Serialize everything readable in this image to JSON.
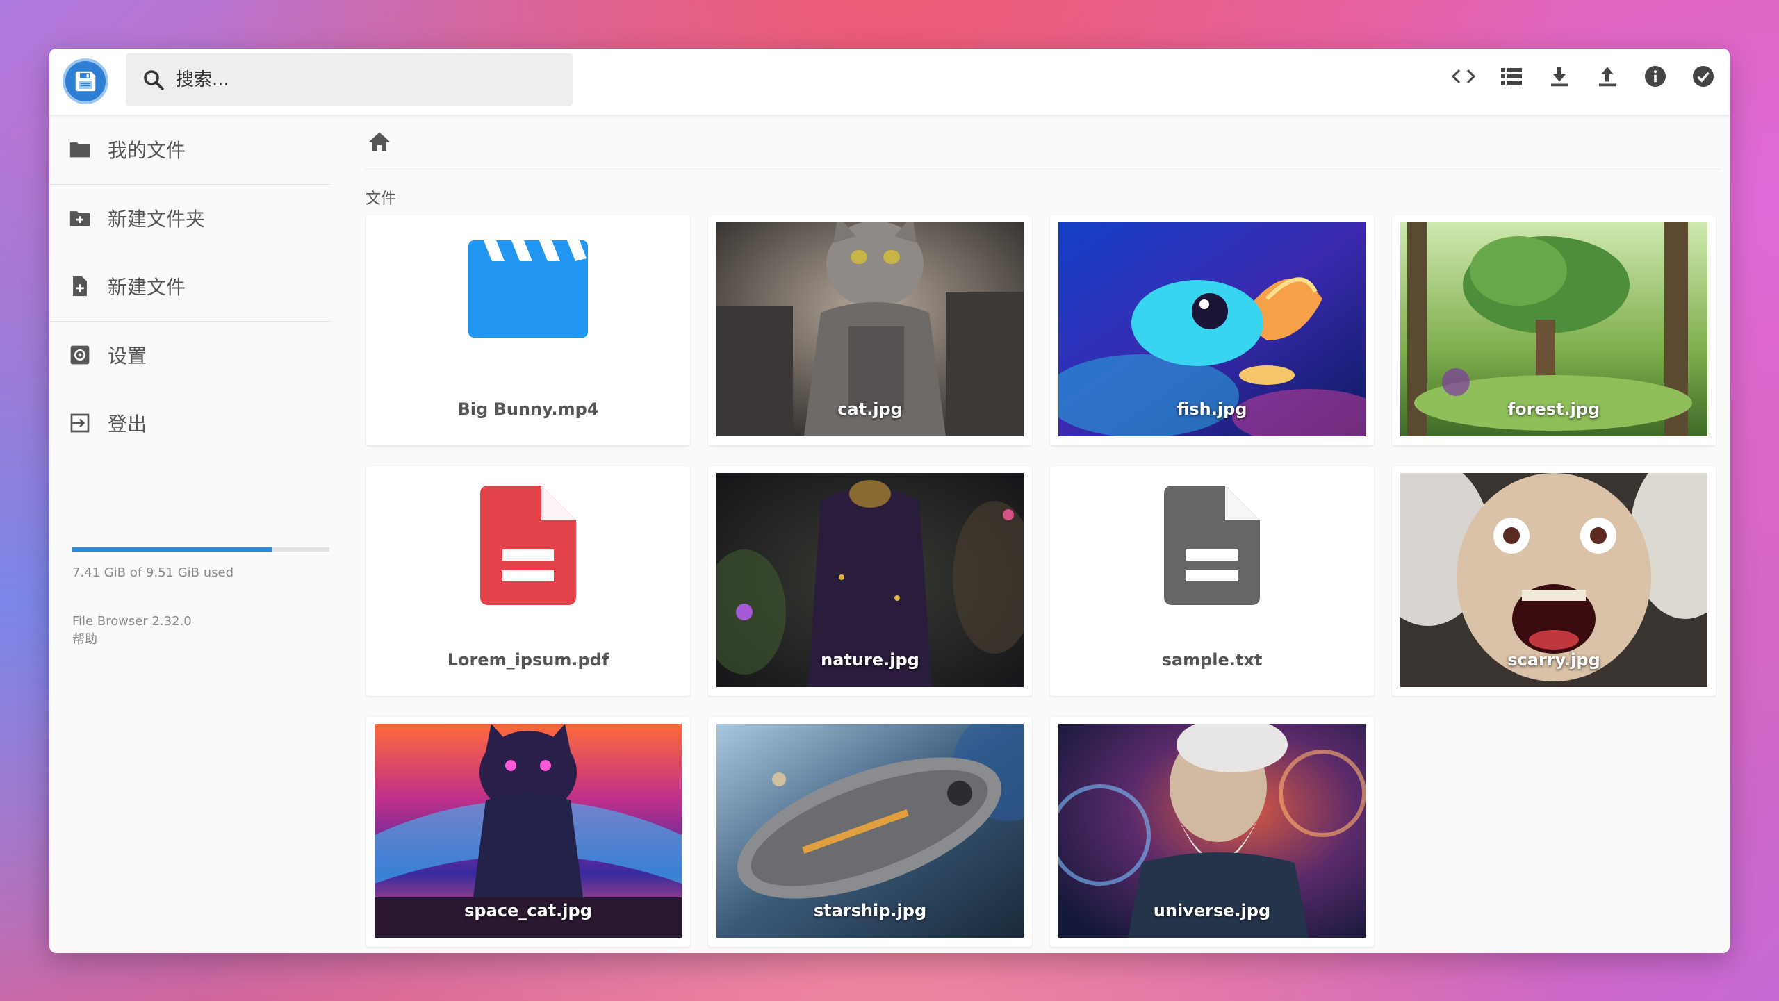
{
  "header": {
    "search_placeholder": "搜索...",
    "actions": [
      "code-icon",
      "list-view-icon",
      "download-icon",
      "upload-icon",
      "info-icon",
      "select-check-icon"
    ]
  },
  "sidebar": {
    "items": [
      {
        "label": "我的文件",
        "icon": "folder-icon"
      },
      {
        "label": "新建文件夹",
        "icon": "create-folder-icon"
      },
      {
        "label": "新建文件",
        "icon": "note-add-icon"
      },
      {
        "label": "设置",
        "icon": "settings-icon"
      },
      {
        "label": "登出",
        "icon": "logout-icon"
      }
    ],
    "usage": {
      "text": "7.41 GiB of 9.51 GiB used",
      "fraction": 0.779
    },
    "version": "File Browser 2.32.0",
    "help": "帮助"
  },
  "section_title": "文件",
  "files": [
    {
      "name": "Big Bunny.mp4",
      "kind": "video",
      "icon": "movie-clapper-icon",
      "color": "#2196f3"
    },
    {
      "name": "cat.jpg",
      "kind": "image"
    },
    {
      "name": "fish.jpg",
      "kind": "image"
    },
    {
      "name": "forest.jpg",
      "kind": "image"
    },
    {
      "name": "Lorem_ipsum.pdf",
      "kind": "pdf",
      "icon": "pdf-document-icon",
      "color": "#e2434b"
    },
    {
      "name": "nature.jpg",
      "kind": "image"
    },
    {
      "name": "sample.txt",
      "kind": "text",
      "icon": "text-document-icon",
      "color": "#666666"
    },
    {
      "name": "scarry.jpg",
      "kind": "image"
    },
    {
      "name": "space_cat.jpg",
      "kind": "image"
    },
    {
      "name": "starship.jpg",
      "kind": "image"
    },
    {
      "name": "universe.jpg",
      "kind": "image"
    }
  ],
  "colors": {
    "accent": "#2f88d8",
    "video": "#2196f3",
    "pdf": "#e2434b",
    "text": "#666666"
  }
}
